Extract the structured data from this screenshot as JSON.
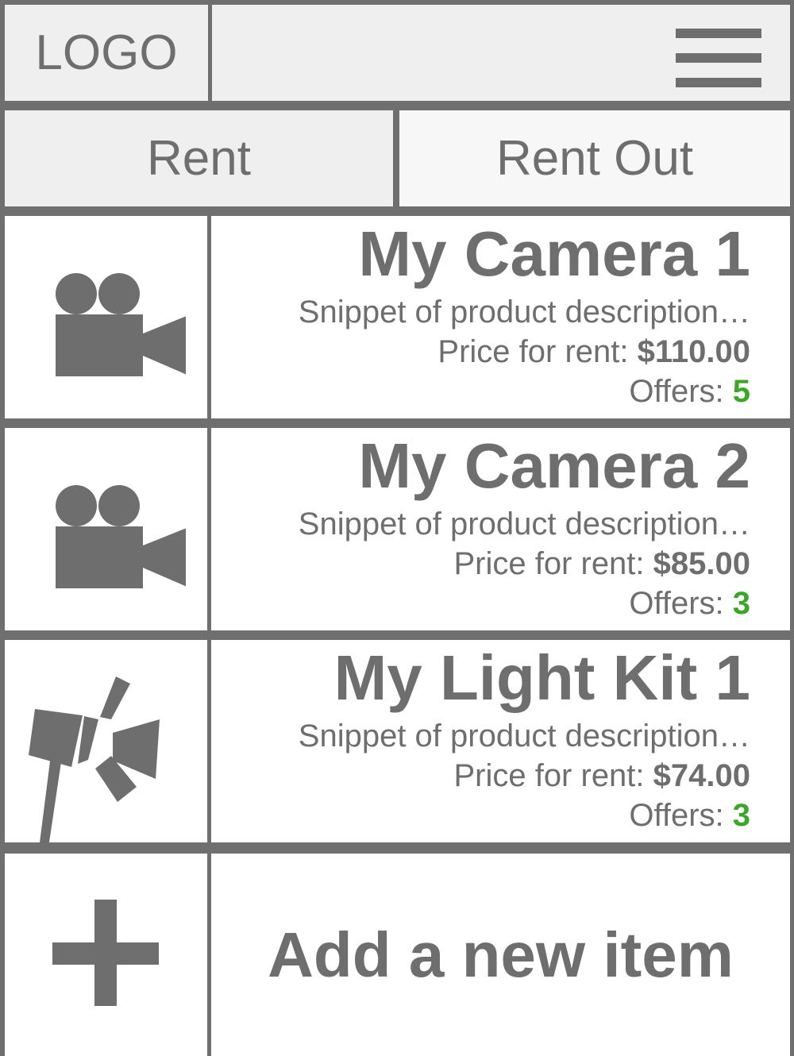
{
  "header": {
    "logo_label": "LOGO",
    "menu_icon": "hamburger-menu-icon"
  },
  "tabs": [
    {
      "label": "Rent"
    },
    {
      "label": "Rent Out"
    }
  ],
  "items": [
    {
      "icon": "video-camera-icon",
      "title": "My Camera 1",
      "description": "Snippet of product description…",
      "price_label": "Price for rent:",
      "price": "$110.00",
      "offers_label": "Offers:",
      "offers": "5"
    },
    {
      "icon": "video-camera-icon",
      "title": "My Camera 2",
      "description": "Snippet of product description…",
      "price_label": "Price for rent:",
      "price": "$85.00",
      "offers_label": "Offers:",
      "offers": "3"
    },
    {
      "icon": "light-kit-icon",
      "title": "My Light Kit 1",
      "description": "Snippet of product description…",
      "price_label": "Price for rent:",
      "price": "$74.00",
      "offers_label": "Offers:",
      "offers": "3"
    }
  ],
  "add_item": {
    "icon": "plus-icon",
    "label": "Add a new item"
  },
  "colors": {
    "text": "#6e6e6e",
    "border": "#6f6f6f",
    "offers_accent": "#3aa826"
  }
}
